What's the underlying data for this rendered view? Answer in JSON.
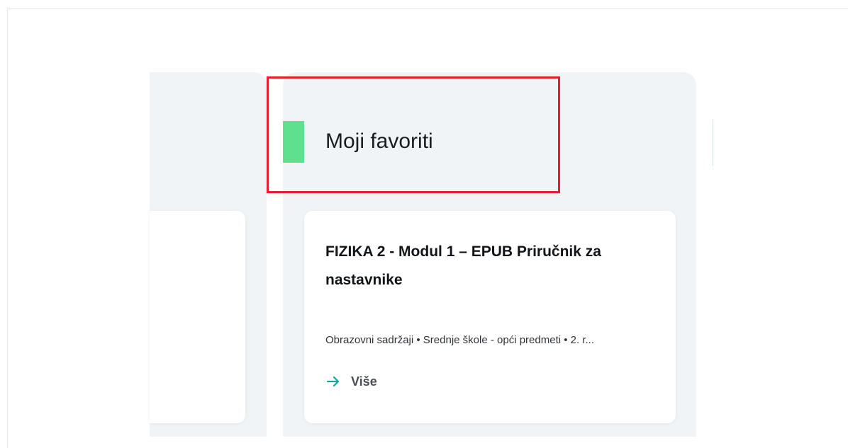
{
  "section": {
    "title": "Moji favoriti"
  },
  "card": {
    "title": "FIZIKA 2 - Modul 1 – EPUB Priručnik za nastavnike",
    "meta": "Obrazovni sadržaji • Srednje škole - opći predmeti • 2. r...",
    "more_label": "Više",
    "more_icon": "arrow-right-icon"
  },
  "colors": {
    "accent": "#5fe08f",
    "highlight": "#e3202b",
    "panel_bg": "#f1f4f7",
    "arrow": "#1aa39a"
  }
}
